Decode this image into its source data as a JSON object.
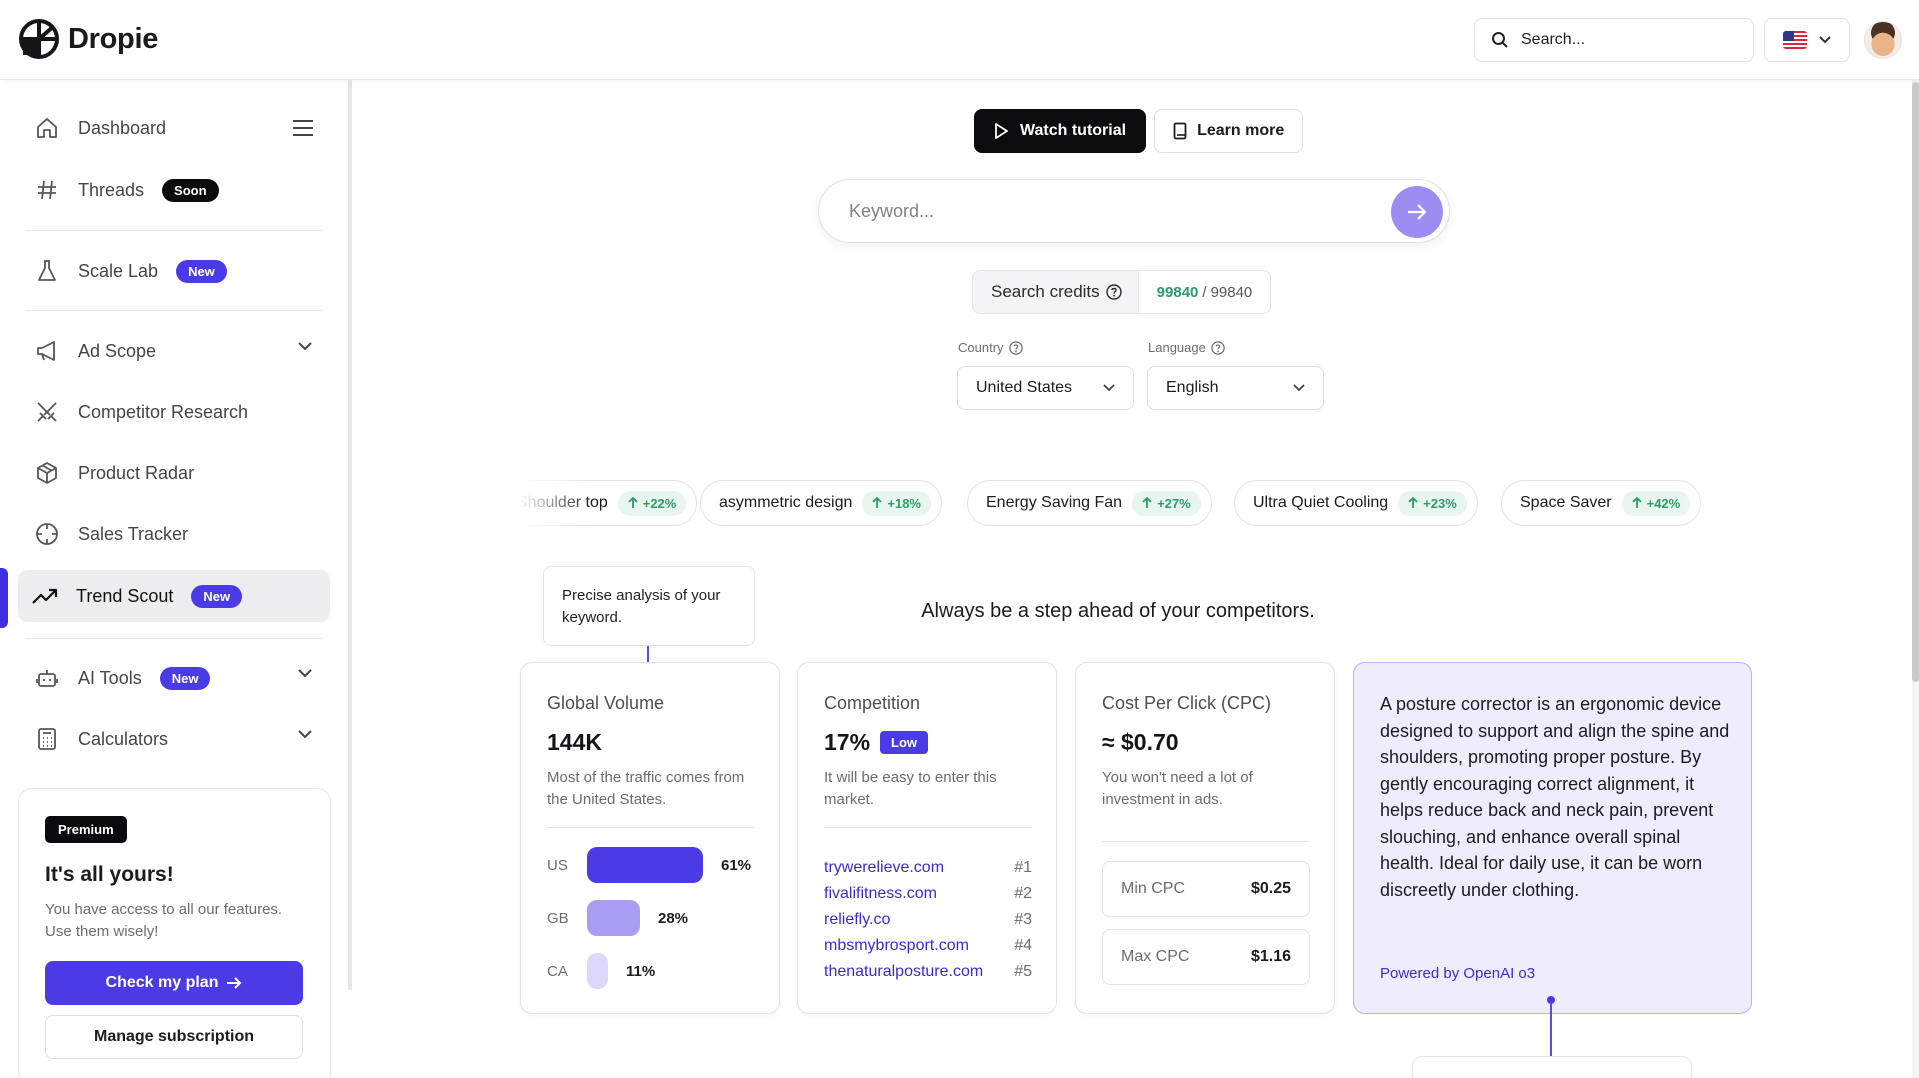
{
  "brand": {
    "name": "Dropie"
  },
  "header": {
    "search_placeholder": "Search...",
    "language_flag": "us-flag-icon"
  },
  "sidebar": {
    "items": [
      {
        "label": "Dashboard",
        "icon": "home-icon"
      },
      {
        "label": "Threads",
        "icon": "hash-icon",
        "badge": "Soon"
      },
      {
        "label": "Scale Lab",
        "icon": "flask-icon",
        "badge": "New"
      },
      {
        "label": "Ad Scope",
        "icon": "megaphone-icon"
      },
      {
        "label": "Competitor Research",
        "icon": "swords-icon"
      },
      {
        "label": "Product Radar",
        "icon": "box-icon"
      },
      {
        "label": "Sales Tracker",
        "icon": "crosshair-icon"
      },
      {
        "label": "Trend Scout",
        "icon": "trending-up-icon",
        "badge": "New",
        "active": true
      },
      {
        "label": "AI Tools",
        "icon": "bot-icon",
        "badge": "New"
      },
      {
        "label": "Calculators",
        "icon": "calculator-icon"
      }
    ],
    "plan": {
      "badge": "Premium",
      "title": "It's all yours!",
      "description": "You have access to all our features. Use them wisely!",
      "check_label": "Check my plan",
      "manage_label": "Manage subscription"
    }
  },
  "main": {
    "watch_label": "Watch tutorial",
    "learn_label": "Learn more",
    "keyword_placeholder": "Keyword...",
    "credits": {
      "label": "Search credits",
      "used": "99840",
      "total": "99840"
    },
    "country": {
      "label": "Country",
      "value": "United States"
    },
    "language": {
      "label": "Language",
      "value": "English"
    },
    "trends": [
      {
        "label": "Shoulder top",
        "pct": "+22%"
      },
      {
        "label": "asymmetric design",
        "pct": "+18%"
      },
      {
        "label": "Energy Saving Fan",
        "pct": "+27%"
      },
      {
        "label": "Ultra Quiet Cooling",
        "pct": "+23%"
      },
      {
        "label": "Space Saver",
        "pct": "+42%"
      }
    ],
    "tooltip": "Precise analysis of your keyword.",
    "tagline": "Always be a step ahead of your competitors.",
    "volume": {
      "title": "Global Volume",
      "value": "144K",
      "description": "Most of the traffic comes from the United States.",
      "countries": [
        {
          "code": "US",
          "pct": "61%",
          "share": 0.61,
          "color": "#4b3be6"
        },
        {
          "code": "GB",
          "pct": "28%",
          "share": 0.28,
          "color": "#a89df3"
        },
        {
          "code": "CA",
          "pct": "11%",
          "share": 0.11,
          "color": "#dcd7fb"
        }
      ]
    },
    "competition": {
      "title": "Competition",
      "value": "17%",
      "level": "Low",
      "description": "It will be easy to enter this market.",
      "sites": [
        {
          "site": "trywerelieve.com",
          "rank": "#1"
        },
        {
          "site": "fivalifitness.com",
          "rank": "#2"
        },
        {
          "site": "reliefly.co",
          "rank": "#3"
        },
        {
          "site": "mbsmybrosport.com",
          "rank": "#4"
        },
        {
          "site": "thenaturalposture.com",
          "rank": "#5"
        }
      ]
    },
    "cpc": {
      "title": "Cost Per Click (CPC)",
      "value": "≈ $0.70",
      "description": "You won't need a lot of investment in ads.",
      "min_label": "Min CPC",
      "min_value": "$0.25",
      "max_label": "Max CPC",
      "max_value": "$1.16"
    },
    "ai": {
      "text": "A posture corrector is an ergonomic device designed to support and align the spine and shoulders, promoting proper posture. By gently encouraging correct alignment, it helps reduce back and neck pain, prevent slouching, and enhance overall spinal health. Ideal for daily use, it can be worn discreetly under clothing.",
      "powered": "Powered by OpenAI o3"
    }
  }
}
